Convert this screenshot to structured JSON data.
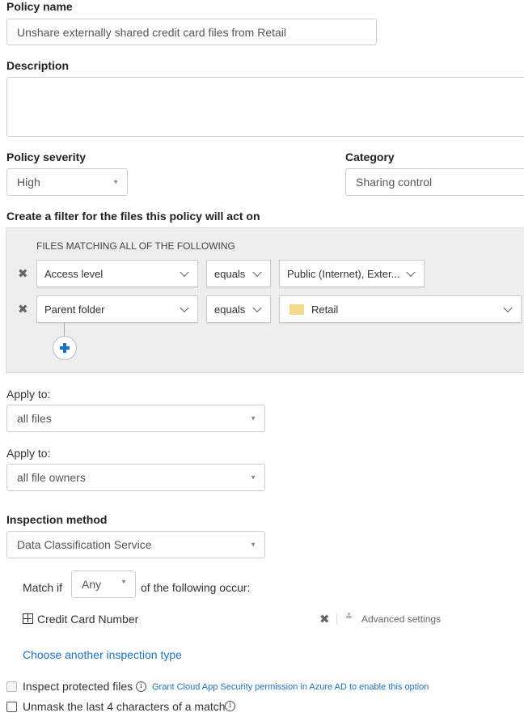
{
  "policy_name": {
    "label": "Policy name",
    "value": "Unshare externally shared credit card files from Retail"
  },
  "description": {
    "label": "Description",
    "value": ""
  },
  "severity": {
    "label": "Policy severity",
    "value": "High"
  },
  "category": {
    "label": "Category",
    "value": "Sharing control"
  },
  "filter": {
    "heading": "Create a filter for the files this policy will act on",
    "group_title": "FILES MATCHING ALL OF THE FOLLOWING",
    "rows": [
      {
        "field": "Access level",
        "operator": "equals",
        "value": "Public (Internet), Exter..."
      },
      {
        "field": "Parent folder",
        "operator": "equals",
        "value": "Retail",
        "value_icon": "folder-icon"
      }
    ],
    "folder_color": "#f5da8e"
  },
  "apply_files": {
    "label": "Apply to:",
    "value": "all files"
  },
  "apply_owners": {
    "label": "Apply to:",
    "value": "all file owners"
  },
  "inspection": {
    "label": "Inspection method",
    "value": "Data Classification Service",
    "match_prefix": "Match if",
    "match_value": "Any",
    "match_suffix": "of the following occur:",
    "item": "Credit Card Number",
    "advanced": "Advanced settings",
    "choose_link": "Choose another inspection type"
  },
  "options": {
    "inspect_protected": {
      "label": "Inspect protected files",
      "checked": false,
      "disabled": true,
      "link": "Grant Cloud App Security permission in Azure AD to enable this option"
    },
    "unmask": {
      "label": "Unmask the last 4 characters of a match",
      "checked": false
    }
  },
  "colors": {
    "link": "#1e73be",
    "panel_bg": "#eeeeee",
    "add_icon": "#1e73be"
  }
}
